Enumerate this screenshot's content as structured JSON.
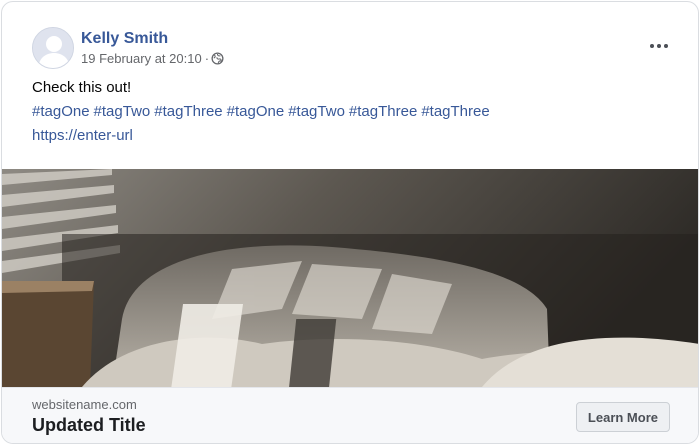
{
  "post": {
    "author": "Kelly Smith",
    "timestamp": "19 February at 20:10",
    "separator": "·",
    "privacy_icon": "globe-icon",
    "more_icon": "more-horizontal-icon",
    "text": "Check this out!",
    "hashtags": [
      "#tagOne",
      "#tagTwo",
      "#tagThree",
      "#tagOne",
      "#tagTwo",
      "#tagThree",
      "#tagThree"
    ],
    "url": "https://enter-url"
  },
  "link_preview": {
    "image": "bedroom-photo",
    "site_name": "websitename.com",
    "title": "Updated Title",
    "cta_label": "Learn More"
  },
  "colors": {
    "link": "#385898",
    "secondary_text": "#65676b",
    "footer_bg": "#f7f8fa"
  }
}
